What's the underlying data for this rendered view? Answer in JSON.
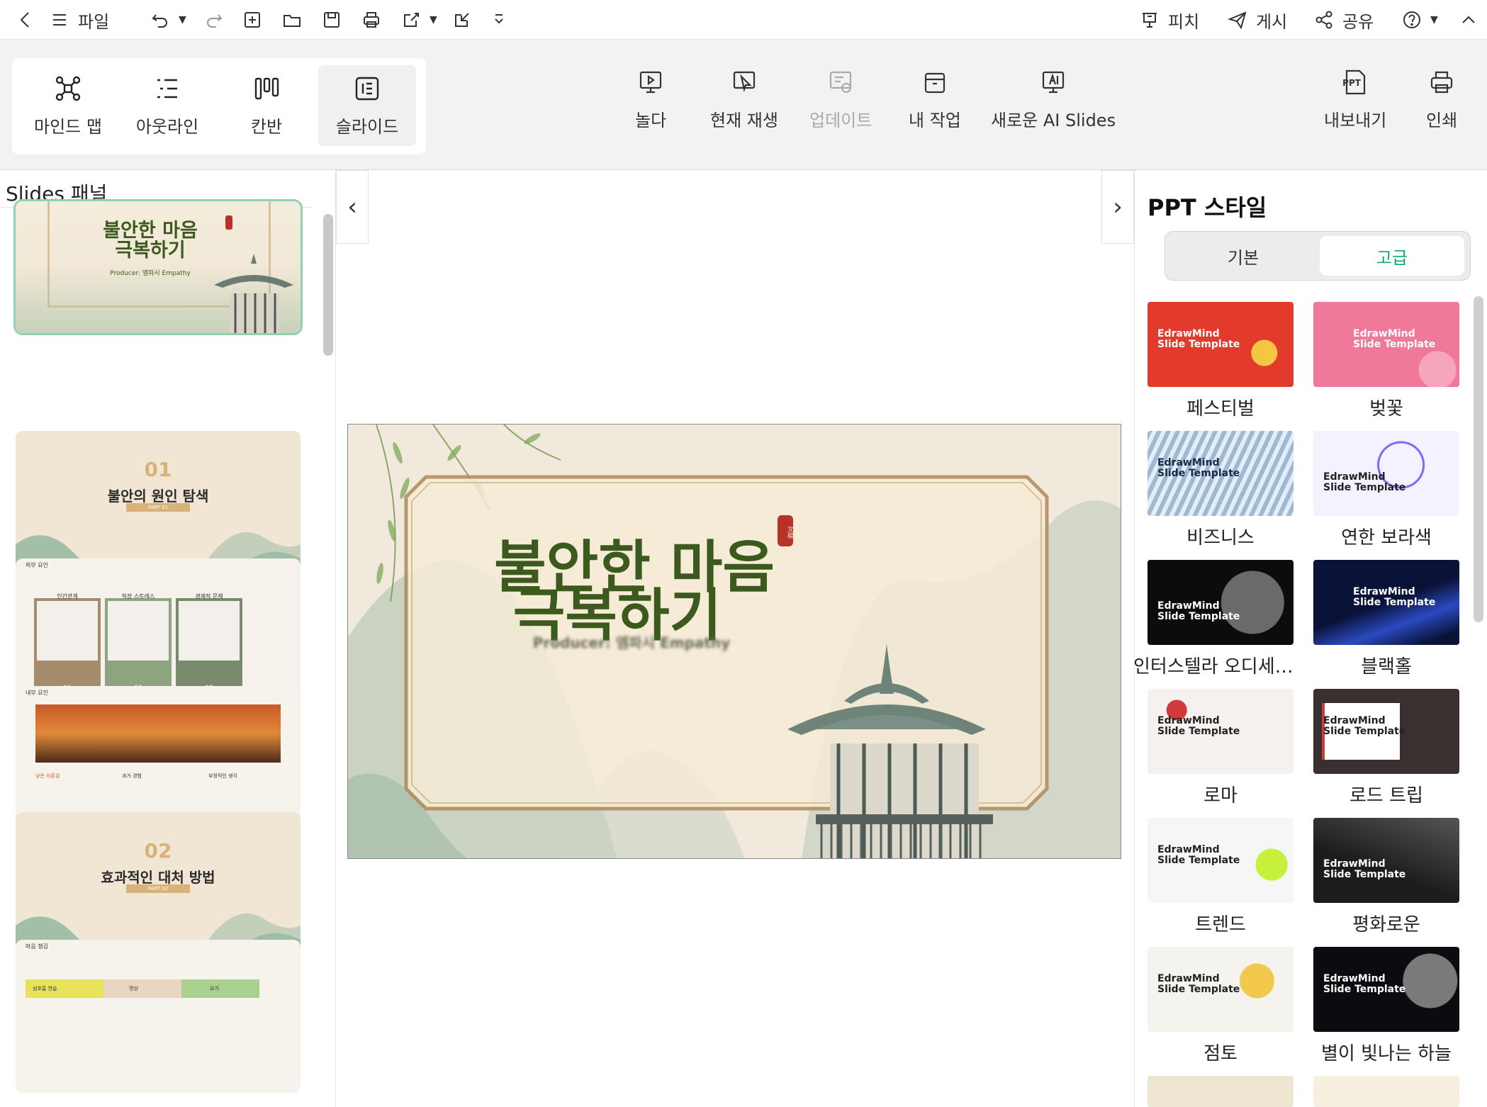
{
  "topbar": {
    "file_label": "파일",
    "pitch_label": "피치",
    "publish_label": "게시",
    "share_label": "공유"
  },
  "views": {
    "mindmap": "마인드 맵",
    "outline": "아웃라인",
    "kanban": "칸반",
    "slides": "슬라이드"
  },
  "ribbon": {
    "play": "놀다",
    "play_current": "현재 재생",
    "update": "업데이트",
    "my_work": "내 작업",
    "new_ai": "새로운 AI Slides",
    "export": "내보내기",
    "print": "인쇄",
    "export_badge": "PPT"
  },
  "left_panel": {
    "title": "Slides 패널",
    "slides": [
      {
        "title": "불안한 마음\n극복하기",
        "subtitle": "Producer: 엠파시 Empathy"
      },
      {
        "number": "01",
        "title": "불안의 원인 탐색",
        "part": "PART 01"
      },
      {
        "header": "외부 요인",
        "cols": [
          "인간관계",
          "직장 스트레스",
          "경제적 문제"
        ],
        "nums": [
          "01",
          "02",
          "03"
        ]
      },
      {
        "header": "내부 요인",
        "cols": [
          "낮은 자존감",
          "과거 경험",
          "부정적인 생각"
        ]
      },
      {
        "number": "02",
        "title": "효과적인 대처 방법",
        "part": "PART 02"
      },
      {
        "header": "마음 챙김",
        "cols": [
          "심호흡 연습",
          "명상",
          "요가"
        ]
      }
    ]
  },
  "main_slide": {
    "title_line1": "불안한 마음",
    "title_line2": "극복하기",
    "subtitle": "Producer: 엠파시 Empathy",
    "seal": "文稿"
  },
  "right_panel": {
    "title": "PPT 스타일",
    "tab_basic": "기본",
    "tab_advanced": "고급",
    "template_text": "EdrawMind\nSlide Template",
    "styles": [
      {
        "name": "페스티벌",
        "bg": "#e23a2c",
        "fg": "#ffffff"
      },
      {
        "name": "벚꽃",
        "bg": "#f0799a",
        "fg": "#ffffff"
      },
      {
        "name": "비즈니스",
        "bg": "#cfe3f4",
        "fg": "#1a2a44"
      },
      {
        "name": "연한 보라색",
        "bg": "#f4f2ff",
        "fg": "#222222"
      },
      {
        "name": "인터스텔라 오디세이...",
        "bg": "#0c0c0c",
        "fg": "#ffffff"
      },
      {
        "name": "블랙홀",
        "bg": "#0a1238",
        "fg": "#ffffff"
      },
      {
        "name": "로마",
        "bg": "#f5f1ee",
        "fg": "#222222"
      },
      {
        "name": "로드 트립",
        "bg": "#3a3030",
        "fg": "#222222"
      },
      {
        "name": "트렌드",
        "bg": "#f6f6f6",
        "fg": "#222222"
      },
      {
        "name": "평화로운",
        "bg": "#1c1c1c",
        "fg": "#ffffff"
      },
      {
        "name": "점토",
        "bg": "#f5f3ee",
        "fg": "#222222"
      },
      {
        "name": "별이 빛나는 하늘",
        "bg": "#0b0b10",
        "fg": "#ffffff"
      }
    ]
  },
  "colors": {
    "accent": "#1aa37a",
    "slide_title": "#3d5a1e",
    "frame": "#b08a5a",
    "selected_outline": "#8fd3b3"
  }
}
